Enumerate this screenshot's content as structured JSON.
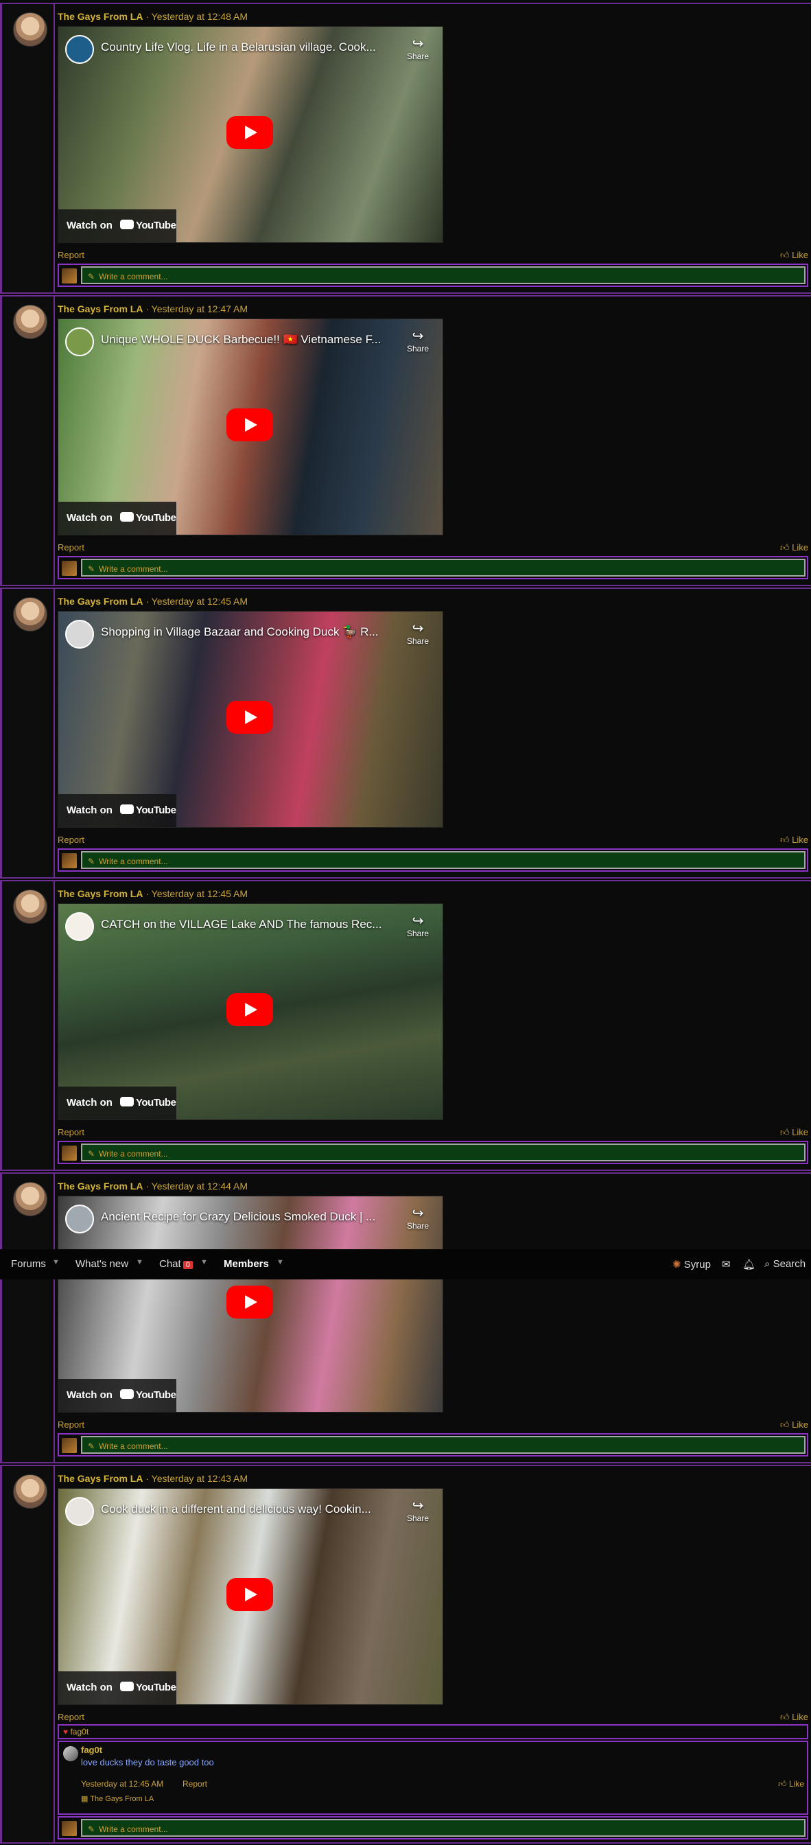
{
  "posts": [
    {
      "author": "The Gays From LA",
      "time": "Yesterday at 12:48 AM",
      "video_title": "Country Life Vlog. Life in a Belarusian village. Cook...",
      "share": "Share",
      "watch": "Watch on",
      "brand": "YouTube",
      "report": "Report",
      "like": "Like",
      "comment_placeholder": "Write a comment..."
    },
    {
      "author": "The Gays From LA",
      "time": "Yesterday at 12:47 AM",
      "video_title": "Unique WHOLE DUCK Barbecue!! 🇻🇳 Vietnamese F...",
      "share": "Share",
      "watch": "Watch on",
      "brand": "YouTube",
      "report": "Report",
      "like": "Like",
      "comment_placeholder": "Write a comment..."
    },
    {
      "author": "The Gays From LA",
      "time": "Yesterday at 12:45 AM",
      "video_title": "Shopping in Village Bazaar and Cooking Duck 🦆 R...",
      "share": "Share",
      "watch": "Watch on",
      "brand": "YouTube",
      "report": "Report",
      "like": "Like",
      "comment_placeholder": "Write a comment..."
    },
    {
      "author": "The Gays From LA",
      "time": "Yesterday at 12:45 AM",
      "video_title": "CATCH on the VILLAGE Lake AND The famous Rec...",
      "share": "Share",
      "watch": "Watch on",
      "brand": "YouTube",
      "report": "Report",
      "like": "Like",
      "comment_placeholder": "Write a comment..."
    },
    {
      "author": "The Gays From LA",
      "time": "Yesterday at 12:44 AM",
      "video_title": "Ancient Recipe for Crazy Delicious Smoked Duck | ...",
      "share": "Share",
      "watch": "Watch on",
      "brand": "YouTube",
      "report": "Report",
      "like": "Like",
      "comment_placeholder": "Write a comment..."
    },
    {
      "author": "The Gays From LA",
      "time": "Yesterday at 12:43 AM",
      "video_title": "Cook duck in a different and delicious way! Cookin...",
      "share": "Share",
      "watch": "Watch on",
      "brand": "YouTube",
      "report": "Report",
      "like": "Like",
      "comment_placeholder": "Write a comment..."
    }
  ],
  "nav": {
    "forums": "Forums",
    "whats_new": "What's new",
    "chat": "Chat",
    "chat_count": "0",
    "members": "Members",
    "user": "Syrup",
    "search": "Search"
  },
  "reply": {
    "reactor": "fag0t",
    "author": "fag0t",
    "text": "love ducks they do taste good too",
    "time": "Yesterday at 12:45 AM",
    "report": "Report",
    "like": "Like",
    "liked_by": "The Gays From LA"
  },
  "colors": {
    "accent_purple": "#8b33c4",
    "gold": "#c9a23a",
    "comment_green": "#0a3d12",
    "youtube_red": "#ff0000"
  }
}
